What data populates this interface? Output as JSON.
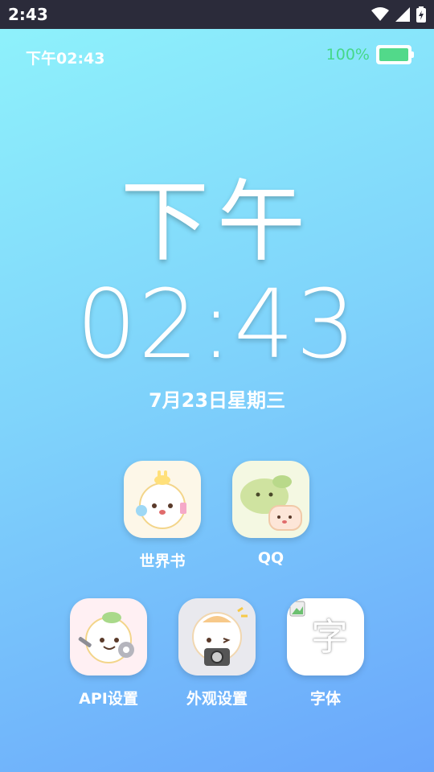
{
  "status_bar": {
    "time": "2:43"
  },
  "top": {
    "time_text": "下午02:43",
    "battery_pct": "100%"
  },
  "clock": {
    "ampm": "下午",
    "time": "02:43",
    "date": "7月23日星期三"
  },
  "apps": [
    {
      "label": "世界书"
    },
    {
      "label": "QQ"
    },
    {
      "label": "API设置"
    },
    {
      "label": "外观设置"
    },
    {
      "label": "字体",
      "icon_char": "字"
    }
  ],
  "colors": {
    "battery": "#52d98a",
    "bg_top": "#8ef1fb",
    "bg_bottom": "#6aa6fb"
  }
}
